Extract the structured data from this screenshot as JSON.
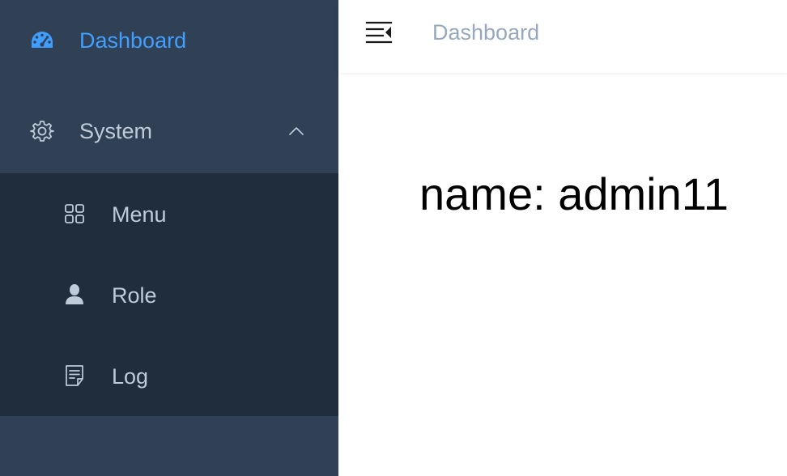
{
  "sidebar": {
    "items": [
      {
        "label": "Dashboard",
        "icon": "dashboard-gauge-icon",
        "active": true
      },
      {
        "label": "System",
        "icon": "gear-icon",
        "expanded": true,
        "chevron": "chevron-up-icon"
      }
    ],
    "submenu": [
      {
        "label": "Menu",
        "icon": "grid-icon"
      },
      {
        "label": "Role",
        "icon": "user-icon"
      },
      {
        "label": "Log",
        "icon": "document-icon"
      }
    ]
  },
  "navbar": {
    "hamburger_icon": "hamburger-collapse-icon",
    "breadcrumb": "Dashboard"
  },
  "main": {
    "text": "name: admin11"
  },
  "colors": {
    "sidebar_bg": "#304156",
    "submenu_bg": "#1f2d3d",
    "active": "#409eff",
    "menu_text": "#bfcbd9",
    "breadcrumb_text": "#97a8be"
  }
}
